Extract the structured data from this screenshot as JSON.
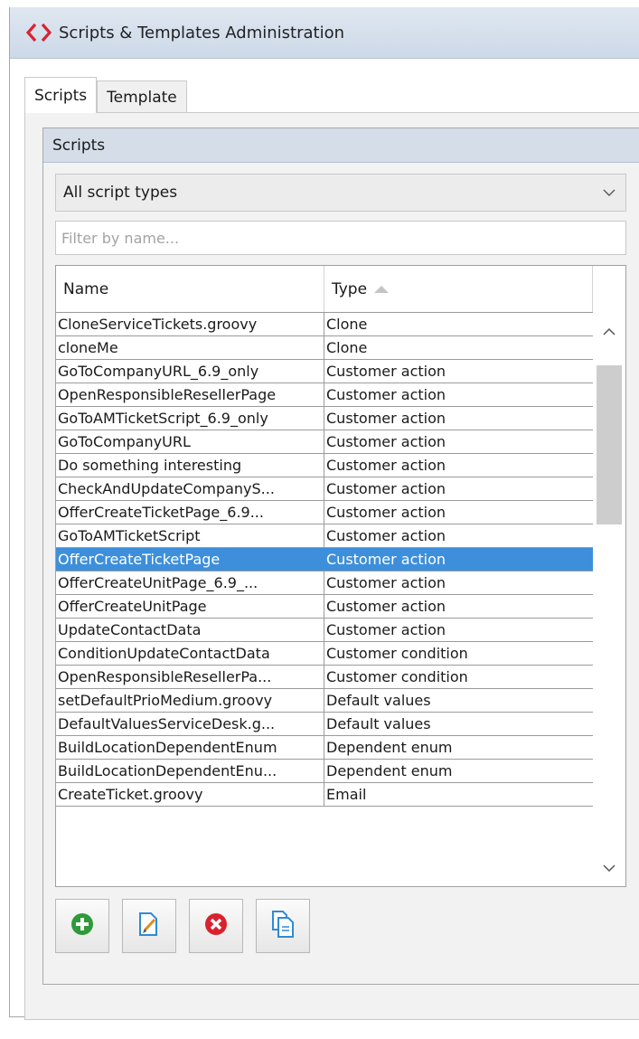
{
  "window": {
    "title": "Scripts & Templates Administration",
    "icon": "code-brackets-icon"
  },
  "tabs": [
    {
      "label": "Scripts",
      "active": true
    },
    {
      "label": "Template",
      "active": false
    }
  ],
  "panel": {
    "title": "Scripts",
    "type_select": {
      "value": "All script types"
    },
    "filter": {
      "placeholder": "Filter by name...",
      "value": ""
    },
    "table": {
      "columns": [
        {
          "label": "Name"
        },
        {
          "label": "Type",
          "sort": "ascending"
        }
      ],
      "selected_index": 10,
      "rows": [
        {
          "name": "CloneServiceTickets.groovy",
          "type": "Clone"
        },
        {
          "name": "cloneMe",
          "type": "Clone"
        },
        {
          "name": "GoToCompanyURL_6.9_only",
          "type": "Customer action"
        },
        {
          "name": "OpenResponsibleResellerPage",
          "type": "Customer action"
        },
        {
          "name": "GoToAMTicketScript_6.9_only",
          "type": "Customer action"
        },
        {
          "name": "GoToCompanyURL",
          "type": "Customer action"
        },
        {
          "name": "Do something interesting",
          "type": "Customer action"
        },
        {
          "name": "CheckAndUpdateCompanyS...",
          "type": "Customer action"
        },
        {
          "name": "OfferCreateTicketPage_6.9...",
          "type": "Customer action"
        },
        {
          "name": "GoToAMTicketScript",
          "type": "Customer action"
        },
        {
          "name": "OfferCreateTicketPage",
          "type": "Customer action"
        },
        {
          "name": "OfferCreateUnitPage_6.9_...",
          "type": "Customer action"
        },
        {
          "name": "OfferCreateUnitPage",
          "type": "Customer action"
        },
        {
          "name": "UpdateContactData",
          "type": "Customer action"
        },
        {
          "name": "ConditionUpdateContactData",
          "type": "Customer condition"
        },
        {
          "name": "OpenResponsibleResellerPa...",
          "type": "Customer condition"
        },
        {
          "name": "setDefaultPrioMedium.groovy",
          "type": "Default values"
        },
        {
          "name": "DefaultValuesServiceDesk.g...",
          "type": "Default values"
        },
        {
          "name": "BuildLocationDependentEnum",
          "type": "Dependent enum"
        },
        {
          "name": "BuildLocationDependentEnu...",
          "type": "Dependent enum"
        },
        {
          "name": "CreateTicket.groovy",
          "type": "Email"
        }
      ]
    },
    "toolbar": [
      {
        "name": "add-button",
        "icon": "plus-circle-icon",
        "color": "#2e9a3a"
      },
      {
        "name": "edit-button",
        "icon": "edit-document-icon",
        "color": "#2f8ad6"
      },
      {
        "name": "delete-button",
        "icon": "x-circle-icon",
        "color": "#d9222f"
      },
      {
        "name": "copy-button",
        "icon": "copy-documents-icon",
        "color": "#2f8ad6"
      }
    ]
  },
  "colors": {
    "selection": "#3d8fdb",
    "header_band": "#d4dde8",
    "accent_red": "#d9222f"
  }
}
